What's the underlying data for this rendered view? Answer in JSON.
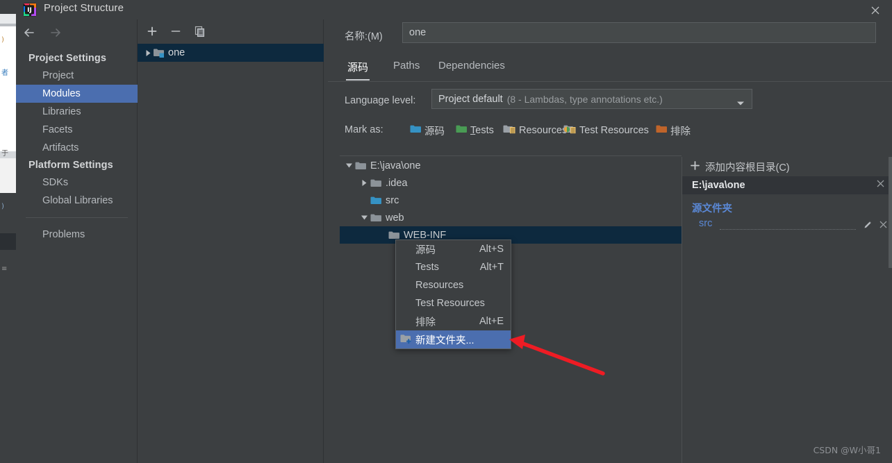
{
  "window": {
    "title": "Project Structure",
    "app_icon": "intellij-idea-logo",
    "close_icon": "close-icon"
  },
  "nav": {
    "back_icon": "arrow-left-icon",
    "forward_icon": "arrow-right-icon",
    "sections": [
      {
        "type": "group",
        "label": "Project Settings"
      },
      {
        "type": "item",
        "label": "Project",
        "selected": false
      },
      {
        "type": "item",
        "label": "Modules",
        "selected": true
      },
      {
        "type": "item",
        "label": "Libraries",
        "selected": false
      },
      {
        "type": "item",
        "label": "Facets",
        "selected": false
      },
      {
        "type": "item",
        "label": "Artifacts",
        "selected": false
      },
      {
        "type": "group",
        "label": "Platform Settings"
      },
      {
        "type": "item",
        "label": "SDKs",
        "selected": false
      },
      {
        "type": "item",
        "label": "Global Libraries",
        "selected": false
      },
      {
        "type": "separator",
        "label": ""
      },
      {
        "type": "item",
        "label": "Problems",
        "selected": false
      }
    ]
  },
  "modules_panel": {
    "toolbar": {
      "add_icon": "plus-icon",
      "remove_icon": "minus-icon",
      "copy_icon": "copy-icon"
    },
    "items": [
      {
        "label": "one",
        "expand_icon": "triangle-right-icon",
        "icon": "module-folder-icon",
        "selected": true
      }
    ]
  },
  "main": {
    "name_label": "名称:(M)",
    "name_value": "one",
    "tabs": [
      {
        "label": "源码",
        "active": true
      },
      {
        "label": "Paths",
        "active": false
      },
      {
        "label": "Dependencies",
        "active": false
      }
    ],
    "language_level": {
      "label": "Language level:",
      "value": "Project default",
      "detail": "(8 - Lambdas, type annotations etc.)",
      "caret_icon": "chevron-down-icon"
    },
    "mark_as": {
      "label": "Mark as:",
      "options": [
        {
          "label": "源码",
          "icon": "folder-blue-icon",
          "color": "#3592c4",
          "mnemonic": ""
        },
        {
          "label": "Tests",
          "icon": "folder-green-icon",
          "color": "#499c54",
          "mnemonic": "T"
        },
        {
          "label": "Resources",
          "icon": "folder-resources-icon",
          "color": "#8a9197",
          "mnemonic": ""
        },
        {
          "label": "Test Resources",
          "icon": "folder-test-resources-icon",
          "color": "#c75450",
          "mnemonic": ""
        },
        {
          "label": "排除",
          "icon": "folder-orange-icon",
          "color": "#c0642a",
          "mnemonic": ""
        }
      ]
    },
    "tree": [
      {
        "label": "E:\\java\\one",
        "indent": 0,
        "twisty": "triangle-down-icon",
        "icon": "folder-gray-icon",
        "selected": false
      },
      {
        "label": ".idea",
        "indent": 1,
        "twisty": "triangle-right-icon",
        "icon": "folder-gray-icon",
        "selected": false
      },
      {
        "label": "src",
        "indent": 1,
        "twisty": "",
        "icon": "folder-blue-icon",
        "selected": false
      },
      {
        "label": "web",
        "indent": 1,
        "twisty": "triangle-down-icon",
        "icon": "folder-gray-icon",
        "selected": false
      },
      {
        "label": "WEB-INF",
        "indent": 2,
        "twisty": "",
        "icon": "folder-gray-icon",
        "selected": true
      }
    ]
  },
  "roots_panel": {
    "add_label": "添加内容根目录(C)",
    "add_icon": "plus-icon",
    "content_root": "E:\\java\\one",
    "content_root_remove_icon": "close-icon",
    "section_label": "源文件夹",
    "entries": [
      {
        "label": "src",
        "edit_icon": "pencil-icon",
        "remove_icon": "close-icon"
      }
    ]
  },
  "context_menu": {
    "items": [
      {
        "label": "源码",
        "shortcut": "Alt+S",
        "highlighted": false,
        "icon": ""
      },
      {
        "label": "Tests",
        "shortcut": "Alt+T",
        "highlighted": false,
        "icon": ""
      },
      {
        "label": "Resources",
        "shortcut": "",
        "highlighted": false,
        "icon": ""
      },
      {
        "label": "Test Resources",
        "shortcut": "",
        "highlighted": false,
        "icon": ""
      },
      {
        "label": "排除",
        "shortcut": "Alt+E",
        "highlighted": false,
        "icon": ""
      },
      {
        "label": "新建文件夹...",
        "shortcut": "",
        "highlighted": true,
        "icon": "folder-add-icon"
      }
    ]
  },
  "annotation": {
    "arrow_icon": "red-arrow-icon",
    "arrow_color": "#ee1c24"
  },
  "watermark": "CSDN @W小哥1",
  "colors": {
    "dialog_bg": "#3c3f41",
    "selection_blue": "#4b6eaf",
    "tree_selection": "#0d293e",
    "link_blue": "#5a88d6",
    "source_folder_blue": "#3592c4"
  }
}
